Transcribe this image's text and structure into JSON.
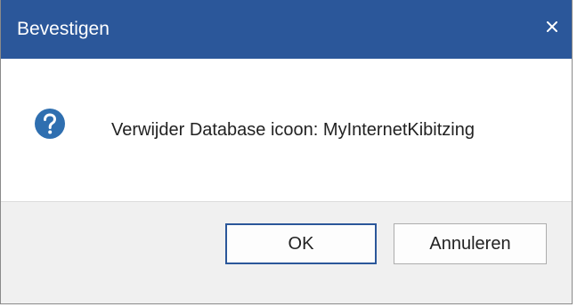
{
  "dialog": {
    "title": "Bevestigen",
    "close_icon": "close-icon",
    "message": "Verwijder Database icoon: MyInternetKibitzing",
    "message_icon": "question-icon",
    "buttons": {
      "ok_label": "OK",
      "cancel_label": "Annuleren"
    }
  },
  "colors": {
    "titlebar": "#2b579a",
    "icon": "#2f6fb0",
    "content_bg": "#ffffff",
    "footer_bg": "#f0f0f0"
  }
}
